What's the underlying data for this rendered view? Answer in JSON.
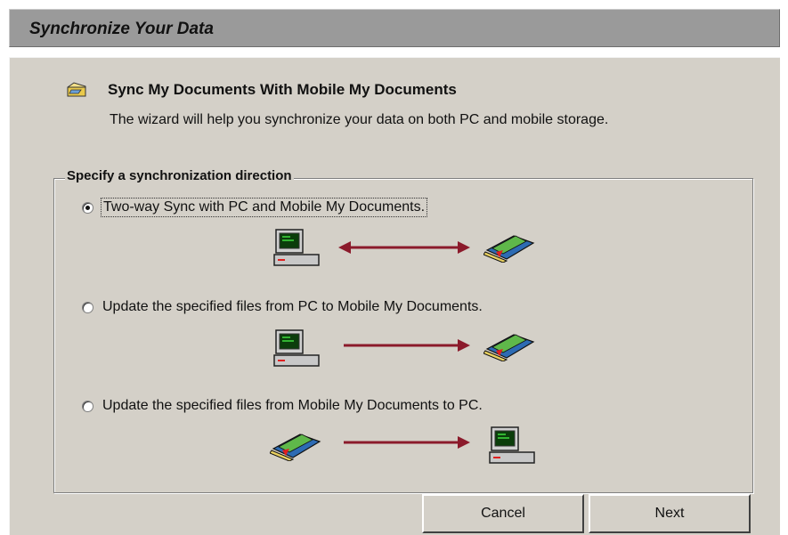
{
  "window": {
    "title": "Synchronize Your Data"
  },
  "section": {
    "icon": "sync-folder-icon",
    "title": "Sync My Documents With Mobile My Documents",
    "description": "The wizard will help you synchronize your data on both PC and mobile storage."
  },
  "direction_group": {
    "legend": "Specify a synchronization direction",
    "options": [
      {
        "label": "Two-way Sync with PC and Mobile My Documents.",
        "selected": true,
        "icons": [
          "pc-icon",
          "double-arrow-icon",
          "mobile-documents-icon"
        ]
      },
      {
        "label": "Update the specified files from PC to Mobile My Documents.",
        "selected": false,
        "icons": [
          "pc-icon",
          "right-arrow-icon",
          "mobile-documents-icon"
        ]
      },
      {
        "label": "Update the specified files from Mobile My Documents to PC.",
        "selected": false,
        "icons": [
          "mobile-documents-icon",
          "right-arrow-icon",
          "pc-icon"
        ]
      }
    ]
  },
  "buttons": {
    "cancel": "Cancel",
    "next": "Next"
  },
  "colors": {
    "arrow": "#8b1a2b",
    "panel": "#d4d0c8",
    "title_bar": "#9a9a9a"
  }
}
